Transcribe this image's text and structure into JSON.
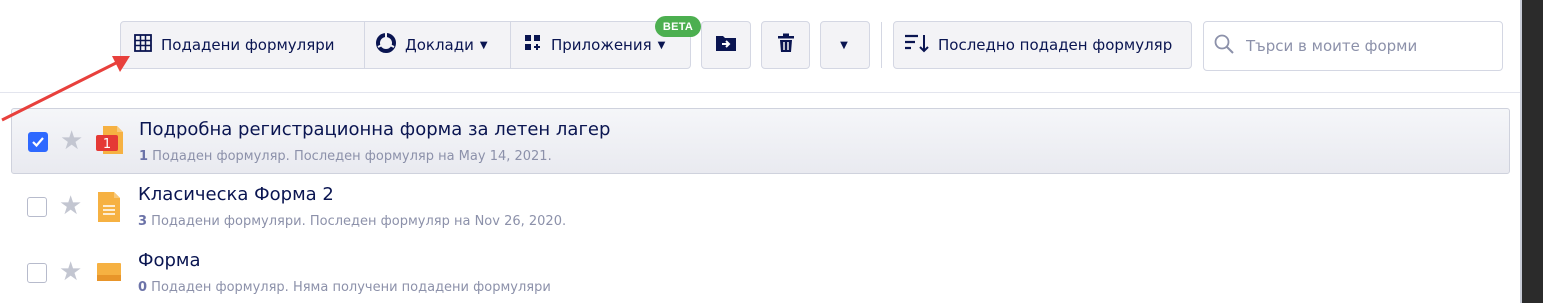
{
  "toolbar": {
    "submissions_label": "Подадени формуляри",
    "reports_label": "Доклади",
    "apps_label": "Приложения",
    "beta_badge": "BETA",
    "sort_label": "Последно подаден формуляр",
    "search_placeholder": "Търси в моите форми"
  },
  "forms": [
    {
      "title": "Подробна регистрационна форма за летен лагер",
      "count": "1",
      "details": " Подаден формуляр. Последен формуляр на May 14, 2021.",
      "badge": "1",
      "selected": true,
      "icon_color": "#ef4444"
    },
    {
      "title": "Класическа Форма 2",
      "count": "3",
      "details": " Подадени формуляри. Последен формуляр на Nov 26, 2020.",
      "selected": false,
      "icon_color": "#f6b142"
    },
    {
      "title": "Форма",
      "count": "0",
      "details": " Подаден формуляр. Няма получени подадени формуляри",
      "selected": false,
      "icon_color": "#f6b142"
    }
  ],
  "colors": {
    "accent": "#2e69ff",
    "beta": "#4caf50",
    "annotation": "#e8403c"
  }
}
